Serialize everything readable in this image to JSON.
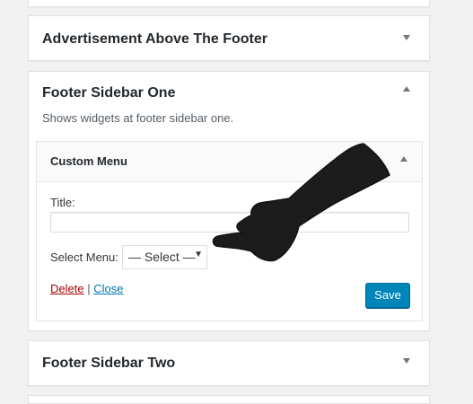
{
  "sections": {
    "advertisement": {
      "title": "Advertisement Above The Footer"
    },
    "footer_one": {
      "title": "Footer Sidebar One",
      "description": "Shows widgets at footer sidebar one.",
      "widget": {
        "title": "Custom Menu",
        "title_field_label": "Title:",
        "title_value": "",
        "select_label": "Select Menu:",
        "select_value": "— Select —",
        "delete_label": "Delete",
        "separator": "|",
        "close_label": "Close",
        "save_label": "Save"
      }
    },
    "footer_two": {
      "title": "Footer Sidebar Two"
    }
  },
  "colors": {
    "save_button": "#0085ba",
    "delete_link": "#aa0000",
    "close_link": "#0073aa",
    "background": "#f1f1f1"
  },
  "icons": {
    "collapsed": "triangle-down-icon",
    "expanded": "triangle-up-icon",
    "overlay": "pointing-hand-icon"
  }
}
